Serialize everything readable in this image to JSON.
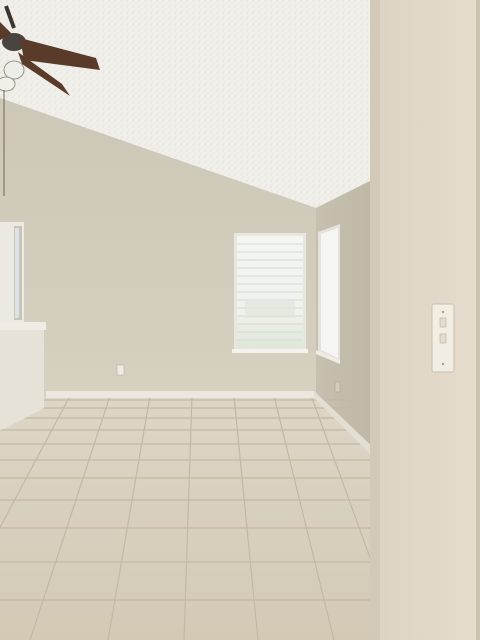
{
  "photo": {
    "subject": "empty-room-interior",
    "elements": [
      "textured-ceiling",
      "ceiling-fan",
      "two-windows-with-blinds",
      "tile-floor",
      "half-wall",
      "wall-outlet-plate"
    ]
  }
}
